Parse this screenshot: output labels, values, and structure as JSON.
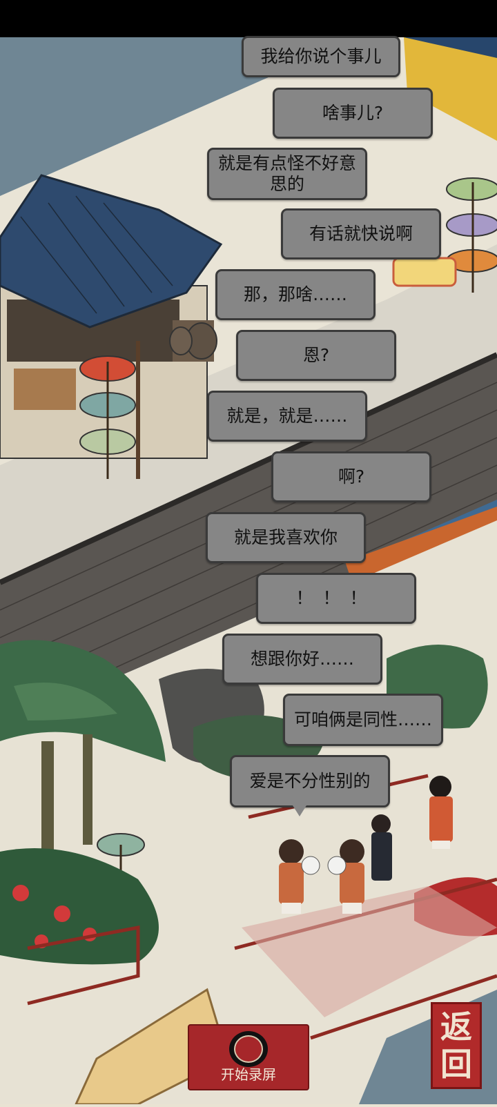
{
  "dialogue": [
    {
      "id": 1,
      "text": "我给你说个事儿"
    },
    {
      "id": 2,
      "text": "啥事儿?"
    },
    {
      "id": 3,
      "text": "就是有点怪不好意思的"
    },
    {
      "id": 4,
      "text": "有话就快说啊"
    },
    {
      "id": 5,
      "text": "那，那啥……"
    },
    {
      "id": 6,
      "text": "恩?"
    },
    {
      "id": 7,
      "text": "就是，就是……"
    },
    {
      "id": 8,
      "text": "啊?"
    },
    {
      "id": 9,
      "text": "就是我喜欢你"
    },
    {
      "id": 10,
      "text": "！！！"
    },
    {
      "id": 11,
      "text": "想跟你好……"
    },
    {
      "id": 12,
      "text": "可咱俩是同性……"
    },
    {
      "id": 13,
      "text": "爱是不分性别的"
    }
  ],
  "controls": {
    "record_label": "开始录屏",
    "back_chars": [
      "返",
      "回"
    ]
  },
  "colors": {
    "bubble_bg": "#868686",
    "button_red": "#a6272a",
    "roof_blue": "#2e4a6e",
    "water": "#6f8694"
  }
}
